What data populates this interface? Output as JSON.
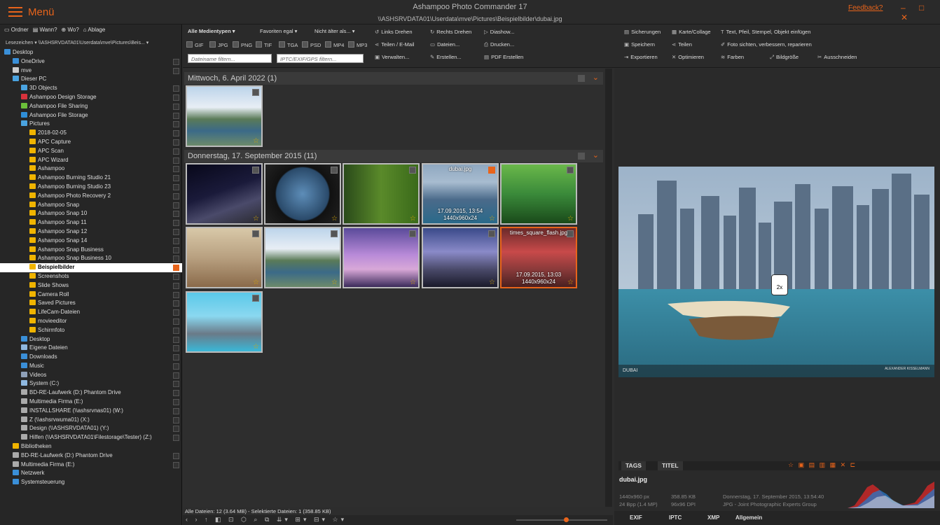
{
  "title": {
    "menu": "Menü",
    "app": "Ashampoo Photo Commander 17",
    "path": "\\\\ASHSRVDATA01\\Userdata\\mve\\Pictures\\Beispielbilder\\dubai.jpg",
    "feedback": "Feedback?",
    "window_controls": "– □ ✕"
  },
  "left": {
    "tabs": [
      "Ordner",
      "Wann?",
      "Wo?",
      "Ablage"
    ],
    "bookmark": "Lesezeichen  ▾  \\\\ASHSRVDATA01\\Userdata\\mve\\Pictures\\Beis...  ▾",
    "tree": [
      {
        "label": "Desktop",
        "indent": 0,
        "color": "#3a8fd8",
        "cb": false
      },
      {
        "label": "OneDrive",
        "indent": 1,
        "color": "#3a8fd8",
        "cb": true
      },
      {
        "label": "mve",
        "indent": 1,
        "color": "#ccc",
        "cb": true
      },
      {
        "label": "Dieser PC",
        "indent": 1,
        "color": "#4aa3e0",
        "cb": false
      },
      {
        "label": "3D Objects",
        "indent": 2,
        "color": "#4aa3e0",
        "cb": true
      },
      {
        "label": "Ashampoo Design Storage",
        "indent": 2,
        "color": "#d8323c",
        "cb": true
      },
      {
        "label": "Ashampoo File Sharing",
        "indent": 2,
        "color": "#6bbf3a",
        "cb": true
      },
      {
        "label": "Ashampoo File Storage",
        "indent": 2,
        "color": "#2f8ed8",
        "cb": true
      },
      {
        "label": "Pictures",
        "indent": 2,
        "color": "#4aa3e0",
        "cb": true
      },
      {
        "label": "2018-02-05",
        "indent": 3,
        "color": "#f0b400",
        "cb": true
      },
      {
        "label": "APC Capture",
        "indent": 3,
        "color": "#f0b400",
        "cb": true
      },
      {
        "label": "APC Scan",
        "indent": 3,
        "color": "#f0b400",
        "cb": true
      },
      {
        "label": "APC Wizard",
        "indent": 3,
        "color": "#f0b400",
        "cb": true
      },
      {
        "label": "Ashampoo",
        "indent": 3,
        "color": "#f0b400",
        "cb": true
      },
      {
        "label": "Ashampoo Burning Studio 21",
        "indent": 3,
        "color": "#f0b400",
        "cb": true
      },
      {
        "label": "Ashampoo Burning Studio 23",
        "indent": 3,
        "color": "#f0b400",
        "cb": true
      },
      {
        "label": "Ashampoo Photo Recovery 2",
        "indent": 3,
        "color": "#f0b400",
        "cb": true
      },
      {
        "label": "Ashampoo Snap",
        "indent": 3,
        "color": "#f0b400",
        "cb": true
      },
      {
        "label": "Ashampoo Snap 10",
        "indent": 3,
        "color": "#f0b400",
        "cb": true
      },
      {
        "label": "Ashampoo Snap 11",
        "indent": 3,
        "color": "#f0b400",
        "cb": true
      },
      {
        "label": "Ashampoo Snap 12",
        "indent": 3,
        "color": "#f0b400",
        "cb": true
      },
      {
        "label": "Ashampoo Snap 14",
        "indent": 3,
        "color": "#f0b400",
        "cb": true
      },
      {
        "label": "Ashampoo Snap Business",
        "indent": 3,
        "color": "#f0b400",
        "cb": true
      },
      {
        "label": "Ashampoo Snap Business 10",
        "indent": 3,
        "color": "#f0b400",
        "cb": true
      },
      {
        "label": "Beispielbilder",
        "indent": 3,
        "color": "#f0b400",
        "cb": true,
        "selected": true
      },
      {
        "label": "Screenshots",
        "indent": 3,
        "color": "#f0b400",
        "cb": true
      },
      {
        "label": "Slide Shows",
        "indent": 3,
        "color": "#f0b400",
        "cb": true
      },
      {
        "label": "Camera Roll",
        "indent": 3,
        "color": "#f0b400",
        "cb": true
      },
      {
        "label": "Saved Pictures",
        "indent": 3,
        "color": "#f0b400",
        "cb": true
      },
      {
        "label": "LifeCam-Dateien",
        "indent": 3,
        "color": "#f0b400",
        "cb": true
      },
      {
        "label": "movieeditor",
        "indent": 3,
        "color": "#f0b400",
        "cb": true
      },
      {
        "label": "Schirmfoto",
        "indent": 3,
        "color": "#f0b400",
        "cb": true
      },
      {
        "label": "Desktop",
        "indent": 2,
        "color": "#3a8fd8",
        "cb": true
      },
      {
        "label": "Eigene Dateien",
        "indent": 2,
        "color": "#8fb8e0",
        "cb": true
      },
      {
        "label": "Downloads",
        "indent": 2,
        "color": "#3a8fd8",
        "cb": true
      },
      {
        "label": "Music",
        "indent": 2,
        "color": "#3a8fd8",
        "cb": true
      },
      {
        "label": "Videos",
        "indent": 2,
        "color": "#8fa0b8",
        "cb": true
      },
      {
        "label": "System (C:)",
        "indent": 2,
        "color": "#8fb8e0",
        "cb": true
      },
      {
        "label": "BD-RE-Laufwerk (D:) Phantom Drive",
        "indent": 2,
        "color": "#aaa",
        "cb": true
      },
      {
        "label": "Multimedia Firma (E:)",
        "indent": 2,
        "color": "#aaa",
        "cb": true
      },
      {
        "label": "INSTALLSHARE (\\\\ashsrvnas01) (W:)",
        "indent": 2,
        "color": "#aaa",
        "cb": true
      },
      {
        "label": "Z (\\\\ashsrvwuma01) (X:)",
        "indent": 2,
        "color": "#aaa",
        "cb": true
      },
      {
        "label": "Design (\\\\ASHSRVDATA01) (Y:)",
        "indent": 2,
        "color": "#aaa",
        "cb": true
      },
      {
        "label": "Hilfen (\\\\ASHSRVDATA01\\Filestorage\\Tester) (Z:)",
        "indent": 2,
        "color": "#aaa",
        "cb": true
      },
      {
        "label": "Bibliotheken",
        "indent": 1,
        "color": "#f0b400",
        "cb": false
      },
      {
        "label": "BD-RE-Laufwerk (D:) Phantom Drive",
        "indent": 1,
        "color": "#aaa",
        "cb": true
      },
      {
        "label": "Multimedia Firma (E:)",
        "indent": 1,
        "color": "#aaa",
        "cb": true
      },
      {
        "label": "Netzwerk",
        "indent": 1,
        "color": "#3a8fd8",
        "cb": false
      },
      {
        "label": "Systemsteuerung",
        "indent": 1,
        "color": "#3a8fd8",
        "cb": false
      }
    ]
  },
  "toolbar": {
    "media_type": "Alle Medientypen  ▾",
    "favorites": "Favoriten egal   ▾",
    "age": "Nicht älter als...  ▾",
    "filters": [
      "GIF",
      "JPG",
      "PNG",
      "TIF",
      "TGA",
      "PSD",
      "MP4",
      "MP3"
    ],
    "filename_placeholder": "Dateiname filtern...",
    "exif_placeholder": "IPTC/EXIF/GPS filtern...",
    "buttons": [
      {
        "label": "Links Drehen",
        "icon": "↺"
      },
      {
        "label": "Rechts Drehen",
        "icon": "↻"
      },
      {
        "label": "Diashow...",
        "icon": "▷"
      },
      {
        "label": "Teilen / E-Mail",
        "icon": "⋖"
      },
      {
        "label": "Dateien...",
        "icon": "▭"
      },
      {
        "label": "Drucken...",
        "icon": "⎙"
      },
      {
        "label": "Verwalten...",
        "icon": "▣"
      },
      {
        "label": "Erstellen...",
        "icon": "✎"
      },
      {
        "label": "PDF Erstellen",
        "icon": "▤"
      },
      {
        "label": "Sicherungen",
        "icon": "▤"
      },
      {
        "label": "Karte/Collage",
        "icon": "▦"
      },
      {
        "label": "Text, Pfeil, Stempel, Objekt einfügen",
        "icon": "T"
      },
      {
        "label": "Speichern",
        "icon": "▣"
      },
      {
        "label": "Teilen",
        "icon": "⋖"
      },
      {
        "label": "Foto sichten, verbessern, reparieren",
        "icon": "✐"
      },
      {
        "label": "Exportieren",
        "icon": "⇥"
      },
      {
        "label": "Optimieren",
        "icon": "✕"
      },
      {
        "label": "Farben",
        "icon": "≋"
      },
      {
        "label": "Bildgröße",
        "icon": "⤢"
      },
      {
        "label": "Ausschneiden",
        "icon": "✂"
      }
    ]
  },
  "groups": [
    {
      "label": "Mittwoch, 6. April 2022 (1)"
    },
    {
      "label": "Donnerstag, 17. September 2015 (11)"
    }
  ],
  "thumbs": [
    {
      "name": "lake-mountains",
      "bg": "linear-gradient(#bcd4ea 0%,#e8eef5 35%,#5a7a58 55%,#3b6a88 75%,#6c8a6a 100%)",
      "star": true
    },
    {
      "name": "night-promenade",
      "bg": "linear-gradient(160deg,#08081a 0%,#1a1a3a 45%,#4a4a6a 70%,#2a2a30 100%)",
      "star": true
    },
    {
      "name": "porthole-sea",
      "bg": "radial-gradient(circle at 50% 50%,#5d8db8 0%,#2a4a6a 55%,#111 58%,#222 100%)",
      "star": true
    },
    {
      "name": "dragonfly",
      "bg": "linear-gradient(90deg,#2a4a1a 0%,#5a8a2a 50%,#3a6a1a 100%)",
      "star": true
    },
    {
      "name": "dubai",
      "bg": "linear-gradient(#8fa8c0 0%,#a8bcd0 30%,#4a6a8a 60%,#2a6a8a 100%)",
      "star": true,
      "checked": true,
      "caption": "dubai.jpg",
      "date": "17.09.2015, 13:54",
      "dims": "1440x960x24"
    },
    {
      "name": "jungle",
      "bg": "linear-gradient(#6ab84a 0%,#3a8a3a 50%,#1a4a1a 100%)",
      "star": true
    },
    {
      "name": "goat",
      "bg": "linear-gradient(#d8c8a8 0%,#b8a080 50%,#8a6a4a 100%)",
      "star": true
    },
    {
      "name": "lake-mountains-2",
      "bg": "linear-gradient(#bcd4ea 0%,#e8eef5 35%,#5a7a58 55%,#3b6a88 75%,#6c8a6a 100%)",
      "star": true
    },
    {
      "name": "purple-city",
      "bg": "linear-gradient(#5a4a9a 0%,#b88ad8 45%,#d8a8d8 70%,#3a2a5a 100%)",
      "star": true
    },
    {
      "name": "skyline-dusk",
      "bg": "linear-gradient(#3a4a8a 0%,#8a8ac8 40%,#4a4a6a 70%,#1a1a2a 100%)",
      "star": true
    },
    {
      "name": "times-square",
      "bg": "linear-gradient(#6a2a2a 0%,#c84a4a 40%,#8a3a3a 70%,#4a2020 100%)",
      "star": true,
      "highlight": true,
      "caption": "times_square_flash.jpg",
      "date": "17.09.2015, 13:03",
      "dims": "1440x960x24"
    },
    {
      "name": "dolphin",
      "bg": "linear-gradient(#5ac8e8 0%,#8ad8f0 40%,#6a7a88 70%,#3ab8d8 100%)",
      "star": true
    }
  ],
  "status": "Alle Dateien: 12 (3.64 MB) - Selektierte Dateien: 1 (358.85 KB)",
  "nav_icons": "‹ › ↑ ◧ ⊡ ⬡ ⌕ ⧉ ⇊▾ ⊞▾ ⊟▾ ☆▾",
  "preview": {
    "zoom_badge": "2x",
    "tabs": [
      "TAGS",
      "TITEL"
    ],
    "rating_icons": "☆ ▣ ▤ ▥ ▦ ✕ ⊏",
    "filename": "dubai.jpg",
    "meta": {
      "dims": "1440x960 px",
      "bpp": "24 Bpp (1.4 MP)",
      "size": "358.85 KB",
      "dpi": "96x96 DPI",
      "date": "Donnerstag, 17. September 2015, 13:54:40",
      "format": "JPG - Joint Photographic Experts Group"
    },
    "meta_tabs": [
      "EXIF",
      "IPTC",
      "XMP",
      "Allgemein"
    ],
    "caption_left": "DUBAI",
    "caption_right": "ALEXANDER KISSELMANN"
  },
  "colors": {
    "accent": "#e8641b",
    "star": "#d9a800",
    "folder": "#f0b400"
  }
}
